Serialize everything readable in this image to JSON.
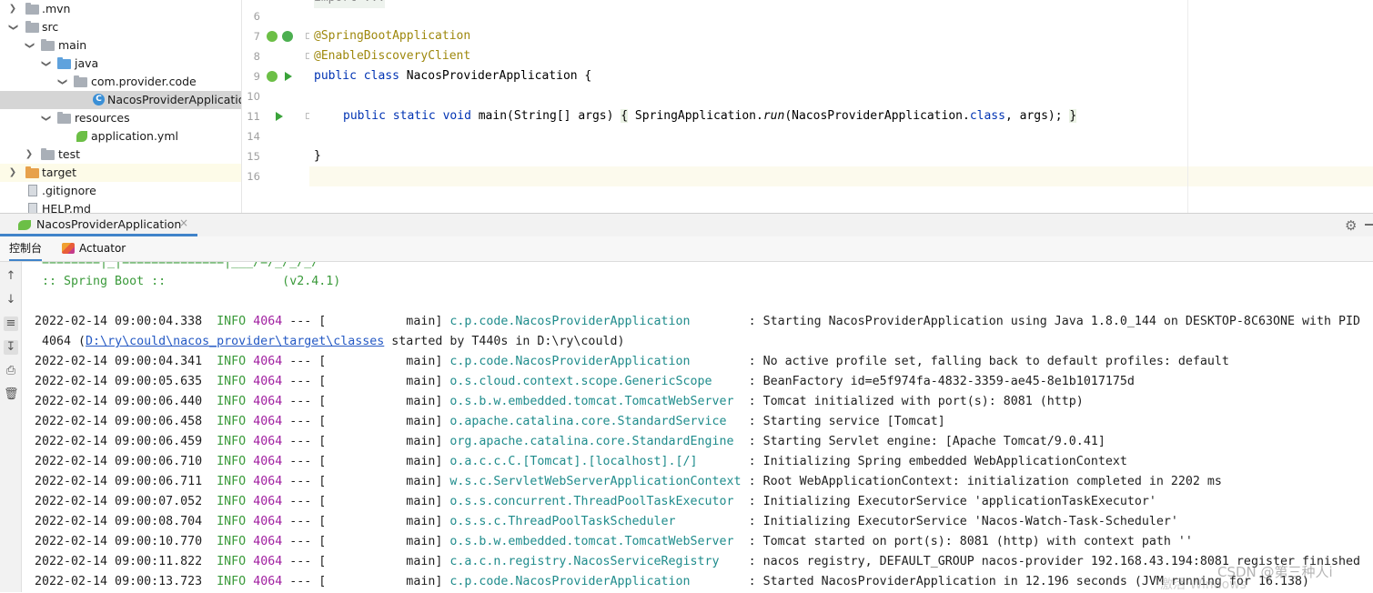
{
  "tree": {
    "items": [
      {
        "label": ".mvn",
        "depth": 0,
        "expanded": false,
        "kind": "folder"
      },
      {
        "label": "src",
        "depth": 0,
        "expanded": true,
        "kind": "folder"
      },
      {
        "label": "main",
        "depth": 1,
        "expanded": true,
        "kind": "folder"
      },
      {
        "label": "java",
        "depth": 2,
        "expanded": true,
        "kind": "source-folder"
      },
      {
        "label": "com.provider.code",
        "depth": 3,
        "expanded": true,
        "kind": "package"
      },
      {
        "label": "NacosProviderApplication",
        "depth": 4,
        "kind": "class",
        "selected": true
      },
      {
        "label": "resources",
        "depth": 2,
        "expanded": true,
        "kind": "resources-folder"
      },
      {
        "label": "application.yml",
        "depth": 3,
        "kind": "yaml"
      },
      {
        "label": "test",
        "depth": 1,
        "expanded": false,
        "kind": "folder"
      },
      {
        "label": "target",
        "depth": 0,
        "expanded": false,
        "kind": "excluded-folder"
      },
      {
        "label": ".gitignore",
        "depth": 0,
        "kind": "file"
      },
      {
        "label": "HELP.md",
        "depth": 0,
        "kind": "file"
      }
    ]
  },
  "editor": {
    "line_numbers": [
      "6",
      "7",
      "8",
      "9",
      "10",
      "11",
      "14",
      "15",
      "16"
    ],
    "top_partial": "import ...",
    "annotation1": "@SpringBootApplication",
    "annotation2": "@EnableDiscoveryClient",
    "class_decl": {
      "kw1": "public",
      "kw2": "class",
      "name": "NacosProviderApplication",
      "brace": " {"
    },
    "main_line": {
      "kw1": "public",
      "kw2": "static",
      "kw3": "void",
      "method": "main",
      "params": "(String[] args)",
      "open": "{",
      "call_prefix": " SpringApplication.",
      "call_method": "run",
      "call_args_a": "(NacosProviderApplication.",
      "call_kw": "class",
      "call_args_b": ", args); ",
      "close": "}"
    },
    "closing_brace": "}"
  },
  "run_window": {
    "tab_label": "NacosProviderApplication",
    "close_glyph": "×",
    "subtab_console": "控制台",
    "subtab_actuator": "Actuator"
  },
  "console": {
    "banner_partial": " ========|_|==============|___/=/_/_/_/",
    "spring_boot": " :: Spring Boot ::                (v2.4.1)",
    "first": {
      "ts": "2022-02-14 09:00:04.338",
      "level": "INFO",
      "pid": "4064",
      "sep": " --- [           main] ",
      "logger": "c.p.code.NacosProviderApplication       ",
      "msg": " : Starting NacosProviderApplication using Java 1.8.0_144 on DESKTOP-8C63ONE with PID",
      "cont_a": " 4064 (",
      "cont_link": "D:\\ry\\could\\nacos_provider\\target\\classes",
      "cont_b": " started by T440s in D:\\ry\\could)"
    },
    "lines": [
      {
        "ts": "2022-02-14 09:00:04.341",
        "level": "INFO",
        "pid": "4064",
        "sep": " --- [           main] ",
        "logger": "c.p.code.NacosProviderApplication       ",
        "msg": " : No active profile set, falling back to default profiles: default"
      },
      {
        "ts": "2022-02-14 09:00:05.635",
        "level": "INFO",
        "pid": "4064",
        "sep": " --- [           main] ",
        "logger": "o.s.cloud.context.scope.GenericScope    ",
        "msg": " : BeanFactory id=e5f974fa-4832-3359-ae45-8e1b1017175d"
      },
      {
        "ts": "2022-02-14 09:00:06.440",
        "level": "INFO",
        "pid": "4064",
        "sep": " --- [           main] ",
        "logger": "o.s.b.w.embedded.tomcat.TomcatWebServer ",
        "msg": " : Tomcat initialized with port(s): 8081 (http)"
      },
      {
        "ts": "2022-02-14 09:00:06.458",
        "level": "INFO",
        "pid": "4064",
        "sep": " --- [           main] ",
        "logger": "o.apache.catalina.core.StandardService  ",
        "msg": " : Starting service [Tomcat]"
      },
      {
        "ts": "2022-02-14 09:00:06.459",
        "level": "INFO",
        "pid": "4064",
        "sep": " --- [           main] ",
        "logger": "org.apache.catalina.core.StandardEngine ",
        "msg": " : Starting Servlet engine: [Apache Tomcat/9.0.41]"
      },
      {
        "ts": "2022-02-14 09:00:06.710",
        "level": "INFO",
        "pid": "4064",
        "sep": " --- [           main] ",
        "logger": "o.a.c.c.C.[Tomcat].[localhost].[/]      ",
        "msg": " : Initializing Spring embedded WebApplicationContext"
      },
      {
        "ts": "2022-02-14 09:00:06.711",
        "level": "INFO",
        "pid": "4064",
        "sep": " --- [           main] ",
        "logger": "w.s.c.ServletWebServerApplicationContext",
        "msg": " : Root WebApplicationContext: initialization completed in 2202 ms"
      },
      {
        "ts": "2022-02-14 09:00:07.052",
        "level": "INFO",
        "pid": "4064",
        "sep": " --- [           main] ",
        "logger": "o.s.s.concurrent.ThreadPoolTaskExecutor ",
        "msg": " : Initializing ExecutorService 'applicationTaskExecutor'"
      },
      {
        "ts": "2022-02-14 09:00:08.704",
        "level": "INFO",
        "pid": "4064",
        "sep": " --- [           main] ",
        "logger": "o.s.s.c.ThreadPoolTaskScheduler         ",
        "msg": " : Initializing ExecutorService 'Nacos-Watch-Task-Scheduler'"
      },
      {
        "ts": "2022-02-14 09:00:10.770",
        "level": "INFO",
        "pid": "4064",
        "sep": " --- [           main] ",
        "logger": "o.s.b.w.embedded.tomcat.TomcatWebServer ",
        "msg": " : Tomcat started on port(s): 8081 (http) with context path ''"
      },
      {
        "ts": "2022-02-14 09:00:11.822",
        "level": "INFO",
        "pid": "4064",
        "sep": " --- [           main] ",
        "logger": "c.a.c.n.registry.NacosServiceRegistry   ",
        "msg": " : nacos registry, DEFAULT_GROUP nacos-provider 192.168.43.194:8081 register finished"
      },
      {
        "ts": "2022-02-14 09:00:13.723",
        "level": "INFO",
        "pid": "4064",
        "sep": " --- [           main] ",
        "logger": "c.p.code.NacosProviderApplication       ",
        "msg": " : Started NacosProviderApplication in 12.196 seconds (JVM running for 16.138)"
      }
    ]
  },
  "watermark": {
    "text": "CSDN @第三种人i",
    "text2": "激活 Windows"
  }
}
